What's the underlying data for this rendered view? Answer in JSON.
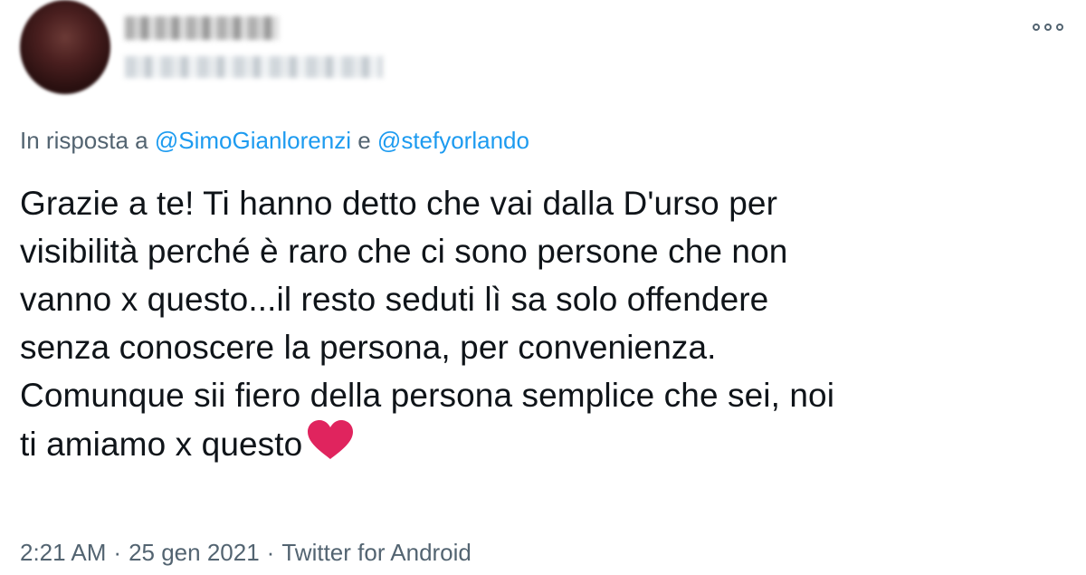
{
  "reply": {
    "prefix": "In risposta a ",
    "mention1": "@SimoGianlorenzi",
    "conjunction": " e ",
    "mention2": "@stefyorlando"
  },
  "tweet": {
    "lines": [
      "Grazie a te! Ti hanno detto che vai dalla D'urso per",
      "visibilità perché è raro che ci sono persone che non",
      "vanno x questo...il resto seduti lì sa solo offendere",
      "senza conoscere la persona, per convenienza.",
      "Comunque sii fiero della persona semplice che sei, noi",
      "ti amiamo x questo"
    ],
    "emoji_icon": "red-heart-icon"
  },
  "meta": {
    "time": "2:21 AM",
    "separator": "·",
    "date": "25 gen 2021",
    "source": "Twitter for Android"
  },
  "icons": {
    "more": "more-options-icon"
  },
  "colors": {
    "text": "#0f1419",
    "secondary": "#536471",
    "link": "#1d9bf0",
    "heart": "#e0245e"
  }
}
